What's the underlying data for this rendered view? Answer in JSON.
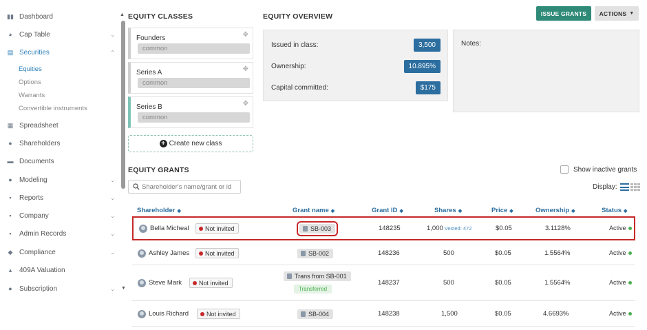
{
  "sidebar": {
    "items": [
      {
        "label": "Dashboard",
        "icon": "dashboard-icon",
        "chevron": false
      },
      {
        "label": "Cap Table",
        "icon": "pie-chart-icon",
        "chevron": true
      },
      {
        "label": "Securities",
        "icon": "document-icon",
        "chevron": true,
        "active": true
      },
      {
        "label": "Spreadsheet",
        "icon": "spreadsheet-icon",
        "chevron": false
      },
      {
        "label": "Shareholders",
        "icon": "user-icon",
        "chevron": false
      },
      {
        "label": "Documents",
        "icon": "folder-icon",
        "chevron": false
      },
      {
        "label": "Modeling",
        "icon": "bulb-icon",
        "chevron": true
      },
      {
        "label": "Reports",
        "icon": "report-icon",
        "chevron": true
      },
      {
        "label": "Company",
        "icon": "building-icon",
        "chevron": true
      },
      {
        "label": "Admin Records",
        "icon": "records-icon",
        "chevron": true
      },
      {
        "label": "Compliance",
        "icon": "shield-icon",
        "chevron": true
      },
      {
        "label": "409A Valuation",
        "icon": "valuation-icon",
        "chevron": false
      },
      {
        "label": "Subscription",
        "icon": "dollar-icon",
        "chevron": true
      }
    ],
    "securities_sub": [
      "Equities",
      "Options",
      "Warrants",
      "Convertible instruments"
    ]
  },
  "equity_classes": {
    "title": "EQUITY CLASSES",
    "classes": [
      {
        "name": "Founders",
        "type": "common"
      },
      {
        "name": "Series A",
        "type": "common"
      },
      {
        "name": "Series B",
        "type": "common"
      }
    ],
    "create_label": "Create new class"
  },
  "overview": {
    "title": "EQUITY OVERVIEW",
    "issued_label": "Issued in class:",
    "issued_value": "3,500",
    "ownership_label": "Ownership:",
    "ownership_value": "10.895%",
    "capital_label": "Capital committed:",
    "capital_value": "$175",
    "notes_label": "Notes:"
  },
  "toolbar": {
    "issue_grants": "ISSUE GRANTS",
    "actions": "ACTIONS"
  },
  "grants": {
    "title": "EQUITY GRANTS",
    "search_placeholder": "Shareholder's name/grant or id",
    "show_inactive": "Show inactive grants",
    "display_label": "Display:",
    "columns": [
      "Shareholder",
      "Grant name",
      "Grant ID",
      "Shares",
      "Price",
      "Ownership",
      "Status"
    ],
    "rows": [
      {
        "shareholder": "Bella Micheal",
        "invite": "Not invited",
        "grant": "SB-003",
        "id": "148235",
        "shares": "1,000",
        "vested": "Vested: 472",
        "price": "$0.05",
        "ownership": "3.1128%",
        "status": "Active"
      },
      {
        "shareholder": "Ashley James",
        "invite": "Not invited",
        "grant": "SB-002",
        "id": "148236",
        "shares": "500",
        "price": "$0.05",
        "ownership": "1.5564%",
        "status": "Active"
      },
      {
        "shareholder": "Steve Mark",
        "invite": "Not invited",
        "grant": "Trans from SB-001",
        "transferred": "Transferred",
        "id": "148237",
        "shares": "500",
        "price": "$0.05",
        "ownership": "1.5564%",
        "status": "Active"
      },
      {
        "shareholder": "Louis Richard",
        "invite": "Not invited",
        "grant": "SB-004",
        "id": "148238",
        "shares": "1,500",
        "price": "$0.05",
        "ownership": "4.6693%",
        "status": "Active"
      }
    ]
  }
}
